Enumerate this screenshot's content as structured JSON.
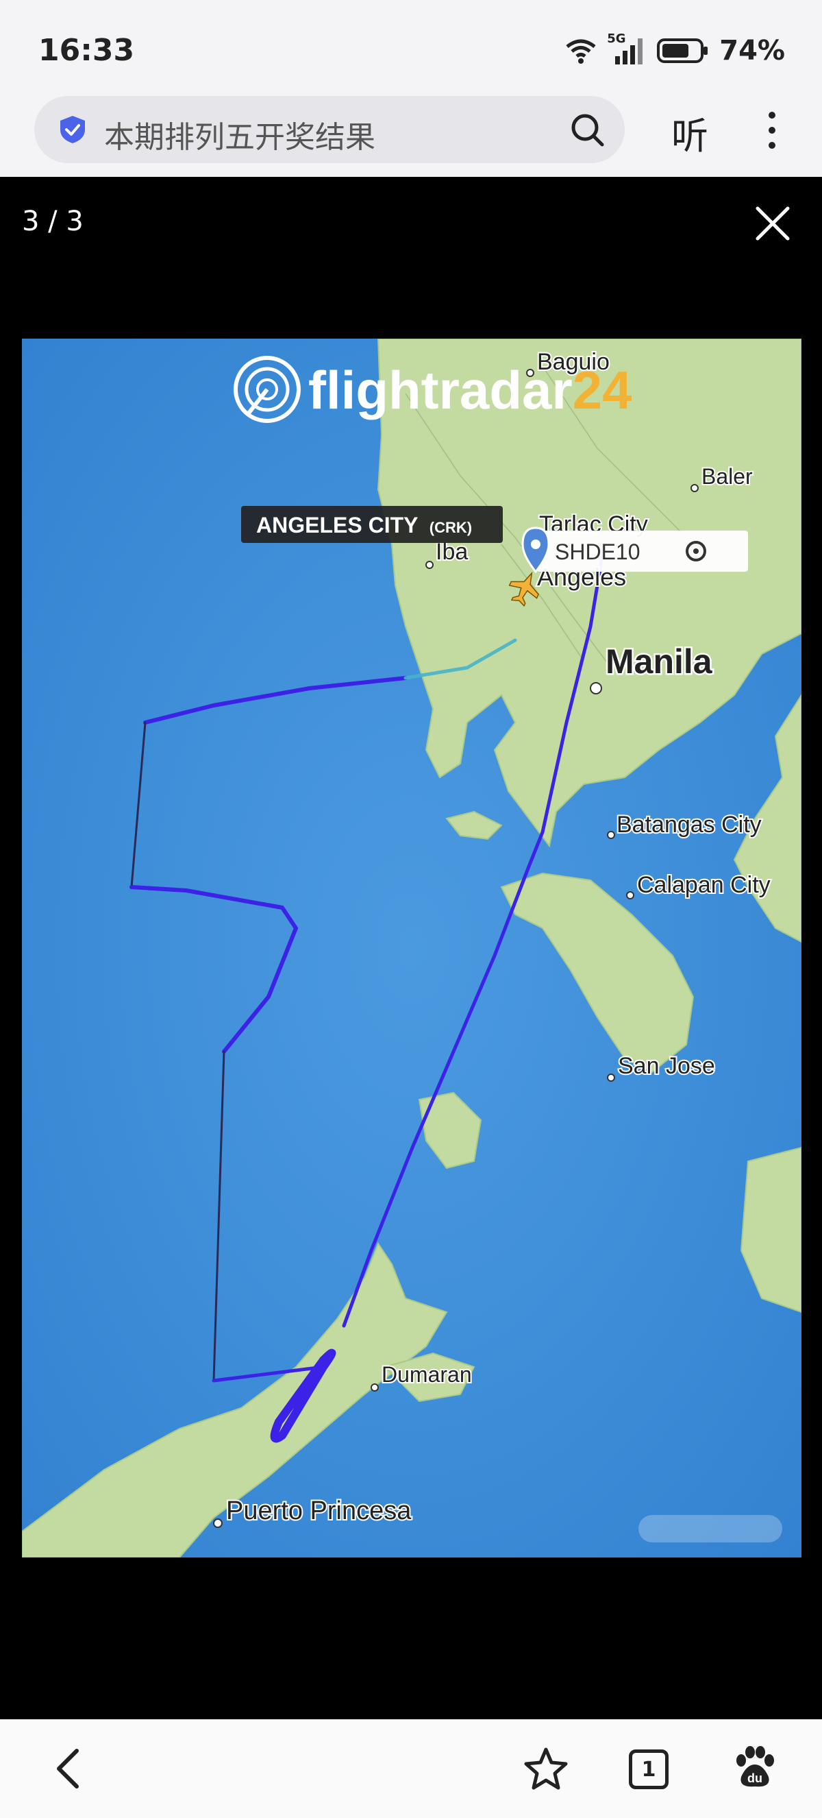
{
  "status_bar": {
    "time": "16:33",
    "network": "5G",
    "battery_percent": "74%",
    "battery_level": 0.74,
    "icons": [
      "wifi-icon",
      "signal-icon",
      "battery-icon"
    ]
  },
  "browser": {
    "search_query": "本期排列五开奖结果",
    "listen_label": "听",
    "icons": [
      "shield-check-icon",
      "search-icon",
      "more-vertical-icon"
    ]
  },
  "viewer": {
    "counter": "3 / 3",
    "close_icon": "close-icon"
  },
  "map": {
    "logo_text": "flightradar",
    "logo_number": "24",
    "airport_label": "ANGELES CITY",
    "airport_code": "(CRK)",
    "flight_callsign": "SHDE10",
    "places": {
      "baguio": "Baguio",
      "baler": "Baler",
      "tarlac": "Tarlac City",
      "iba": "Iba",
      "angeles": "Angeles",
      "manila": "Manila",
      "batangas": "Batangas City",
      "calapan": "Calapan City",
      "san_jose": "San Jose",
      "dumaran": "Dumaran",
      "puerto_princesa": "Puerto Princesa"
    },
    "colors": {
      "sea": "#3f8fd6",
      "land": "#c3dba0",
      "track": "#3b22e6"
    }
  },
  "bottom_nav": {
    "tab_count": "1",
    "icons": [
      "back-icon",
      "star-icon",
      "tabs-icon",
      "baidu-paw-icon"
    ]
  }
}
